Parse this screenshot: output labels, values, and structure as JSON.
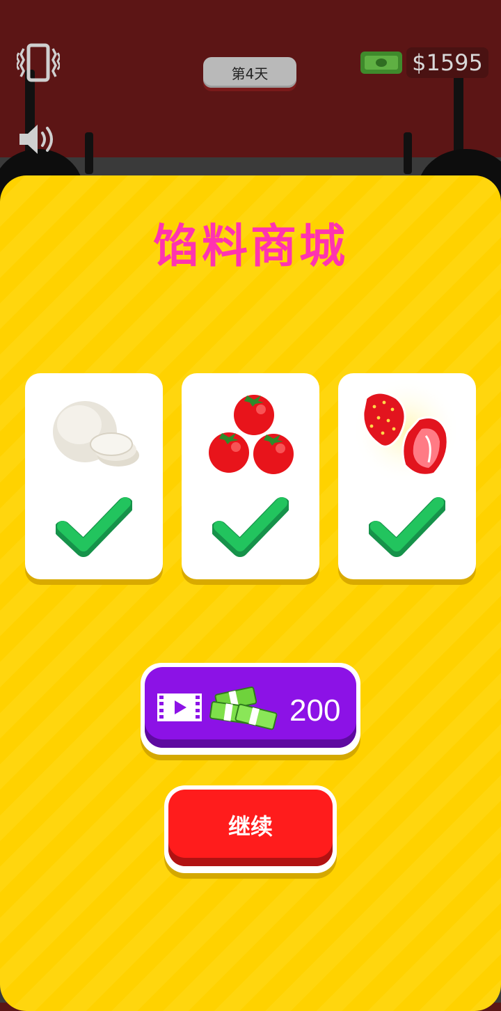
{
  "hud": {
    "day_label": "第4天",
    "money": "$1595",
    "vibrate_icon": "vibrate-phone-icon",
    "sound_icon": "speaker-icon",
    "cash_icon": "cash-icon"
  },
  "shop": {
    "title": "馅料商城",
    "items": [
      {
        "icon": "mozzarella-icon",
        "owned": true
      },
      {
        "icon": "tomatoes-icon",
        "owned": true
      },
      {
        "icon": "strawberries-icon",
        "owned": true
      }
    ],
    "ad_button": {
      "video_icon": "video-ad-icon",
      "cash_icon": "cash-stack-icon",
      "amount": "200"
    },
    "continue_label": "继续"
  },
  "colors": {
    "panel": "#ffd200",
    "title": "#ff33b0",
    "ad_button": "#8c12e6",
    "continue_button": "#ff1c1c",
    "check": "#22c45e"
  }
}
